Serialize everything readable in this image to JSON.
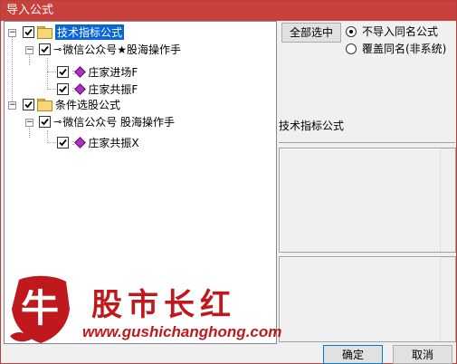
{
  "window": {
    "title": "导入公式"
  },
  "tree": {
    "groups": [
      {
        "label": "技术指标公式",
        "selected": true,
        "checked": true,
        "children": [
          {
            "label": "微信公众号★股海操作手",
            "checked": true,
            "items": [
              {
                "label": "庄家进场F",
                "checked": true
              },
              {
                "label": "庄家共振F",
                "checked": true
              }
            ]
          }
        ]
      },
      {
        "label": "条件选股公式",
        "selected": false,
        "checked": true,
        "children": [
          {
            "label": "微信公众号 股海操作手",
            "checked": true,
            "items": [
              {
                "label": "庄家共振X",
                "checked": true
              }
            ]
          }
        ]
      }
    ]
  },
  "options": {
    "select_all_label": "全部选中",
    "radio_options": [
      {
        "label": "不导入同名公式",
        "selected": true
      },
      {
        "label": "覆盖同名(非系统)",
        "selected": false
      }
    ]
  },
  "detail": {
    "category_label": "技术指标公式"
  },
  "footer": {
    "ok_label": "确定",
    "cancel_label": "取消"
  },
  "watermark": {
    "logo_char": "牛",
    "brand": "股市长红",
    "url": "www.gushichanghong.com"
  },
  "colors": {
    "title_bar": "#c8413c",
    "selection": "#0a66d6",
    "watermark": "#c0191d"
  }
}
